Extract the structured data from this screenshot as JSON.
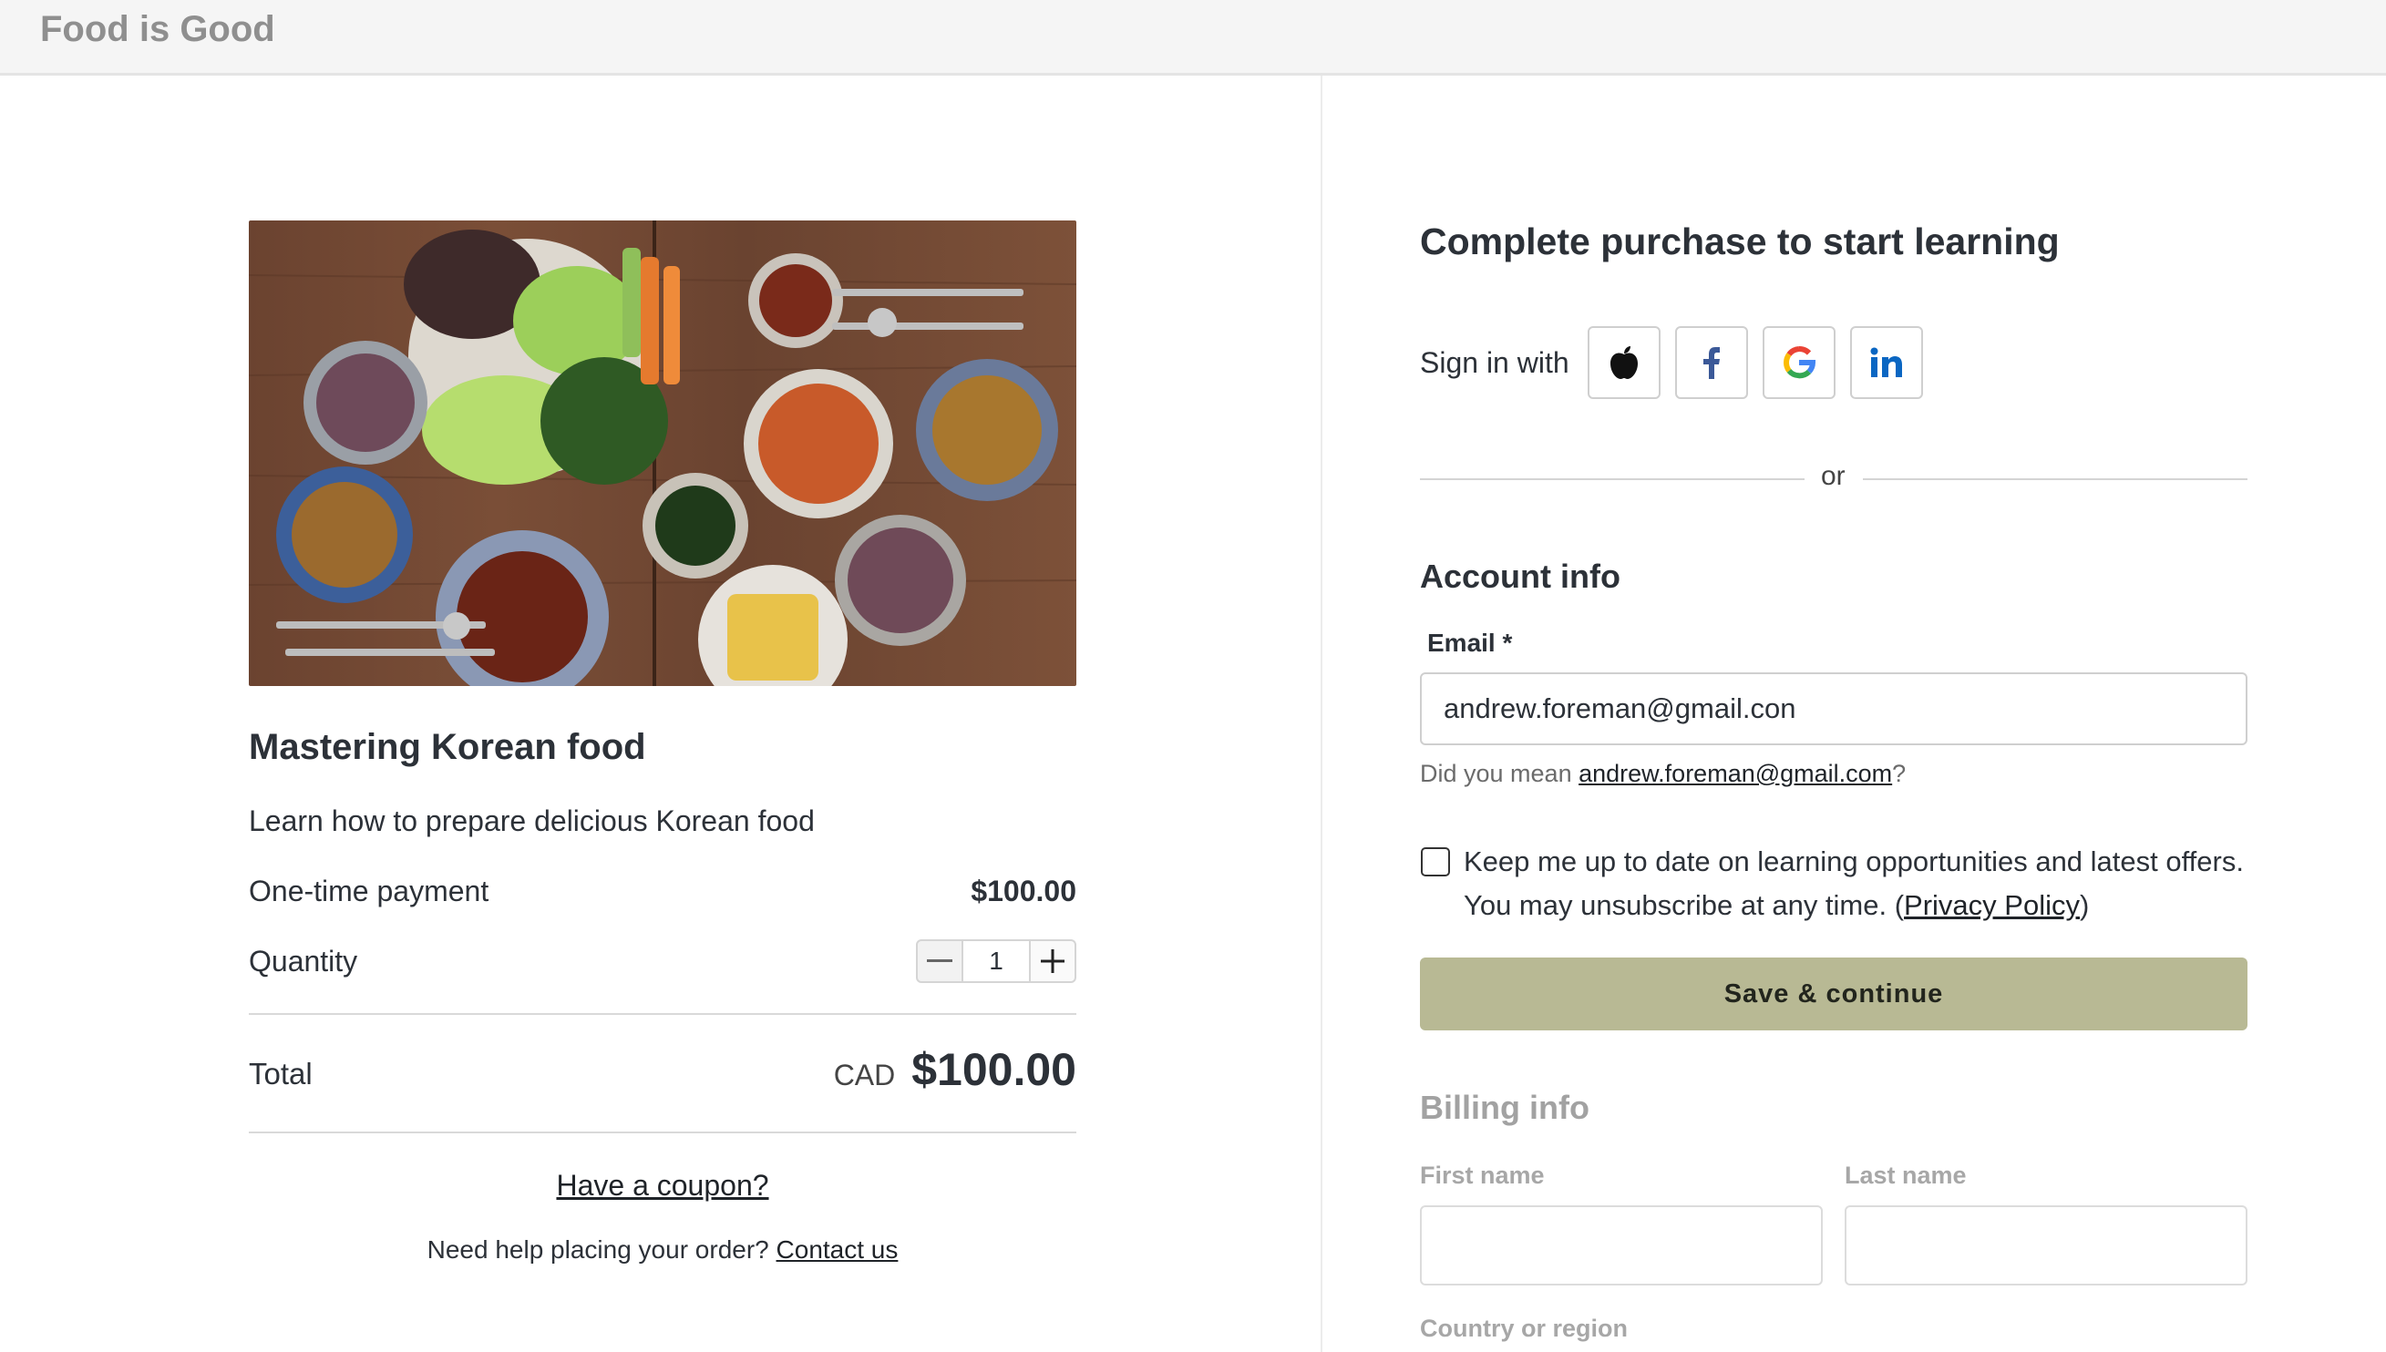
{
  "app": {
    "brand": "Food is Good"
  },
  "product": {
    "image_alt": "Korean food spread",
    "title": "Mastering Korean food",
    "description": "Learn how to prepare delicious Korean food",
    "payment_label": "One-time payment",
    "payment_value": "$100.00",
    "quantity_label": "Quantity",
    "quantity_value": "1",
    "total_label": "Total",
    "currency": "CAD",
    "total_value": "$100.00",
    "coupon_link": "Have a coupon?",
    "help_text": "Need help placing your order?",
    "contact_link": "Contact us"
  },
  "checkout": {
    "title": "Complete purchase to start learning",
    "signin_label": "Sign in with",
    "social": [
      "apple-icon",
      "facebook-icon",
      "google-icon",
      "linkedin-icon"
    ],
    "or": "or",
    "account_title": "Account info",
    "email_label": "Email *",
    "email_value": "andrew.foreman@gmail.con",
    "suggest_prefix": "Did you mean",
    "suggest_link": "andrew.foreman@gmail.com",
    "suggest_suffix": "?",
    "optin_text": "Keep me up to date on learning opportunities and latest offers. You may unsubscribe at any time. (",
    "privacy_link": "Privacy Policy",
    "optin_close": ")",
    "save_button": "Save & continue",
    "billing_title": "Billing info",
    "first_name_label": "First name",
    "last_name_label": "Last name",
    "country_label": "Country or region"
  },
  "colors": {
    "accent_button": "#b8b994",
    "text": "#2c3138",
    "muted": "#a2a2a2",
    "facebook": "#3b5998",
    "linkedin": "#0a66c2"
  }
}
